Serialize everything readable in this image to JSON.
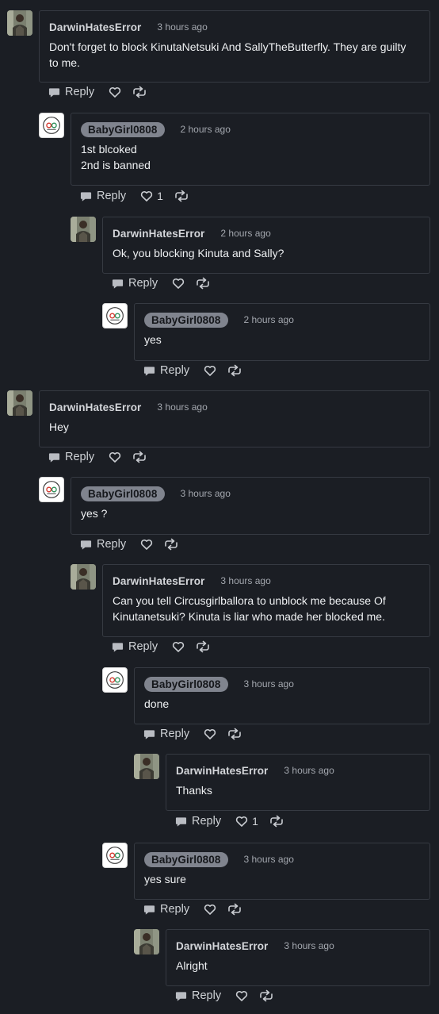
{
  "actions": {
    "reply_label": "Reply"
  },
  "comments": [
    {
      "author": "DarwinHatesError",
      "time": "3 hours ago",
      "text": "Don't forget to block KinutaNetsuki And SallyTheButterfly. They are guilty\nto me.",
      "likes": ""
    },
    {
      "author": "BabyGirl0808",
      "time": "2 hours ago",
      "text": "1st blcoked\n2nd is banned",
      "likes": "1"
    },
    {
      "author": "DarwinHatesError",
      "time": "2 hours ago",
      "text": "Ok, you blocking Kinuta and Sally?",
      "likes": ""
    },
    {
      "author": "BabyGirl0808",
      "time": "2 hours ago",
      "text": "yes",
      "likes": ""
    },
    {
      "author": "DarwinHatesError",
      "time": "3 hours ago",
      "text": "Hey",
      "likes": ""
    },
    {
      "author": "BabyGirl0808",
      "time": "3 hours ago",
      "text": "yes ?",
      "likes": ""
    },
    {
      "author": "DarwinHatesError",
      "time": "3 hours ago",
      "text": "Can you tell Circusgirlballora to unblock me because Of\nKinutanetsuki? Kinuta is liar who made her blocked me.",
      "likes": ""
    },
    {
      "author": "BabyGirl0808",
      "time": "3 hours ago",
      "text": "done",
      "likes": ""
    },
    {
      "author": "DarwinHatesError",
      "time": "3 hours ago",
      "text": "Thanks",
      "likes": "1"
    },
    {
      "author": "BabyGirl0808",
      "time": "3 hours ago",
      "text": "yes sure",
      "likes": ""
    },
    {
      "author": "DarwinHatesError",
      "time": "3 hours ago",
      "text": "Alright",
      "likes": ""
    }
  ]
}
